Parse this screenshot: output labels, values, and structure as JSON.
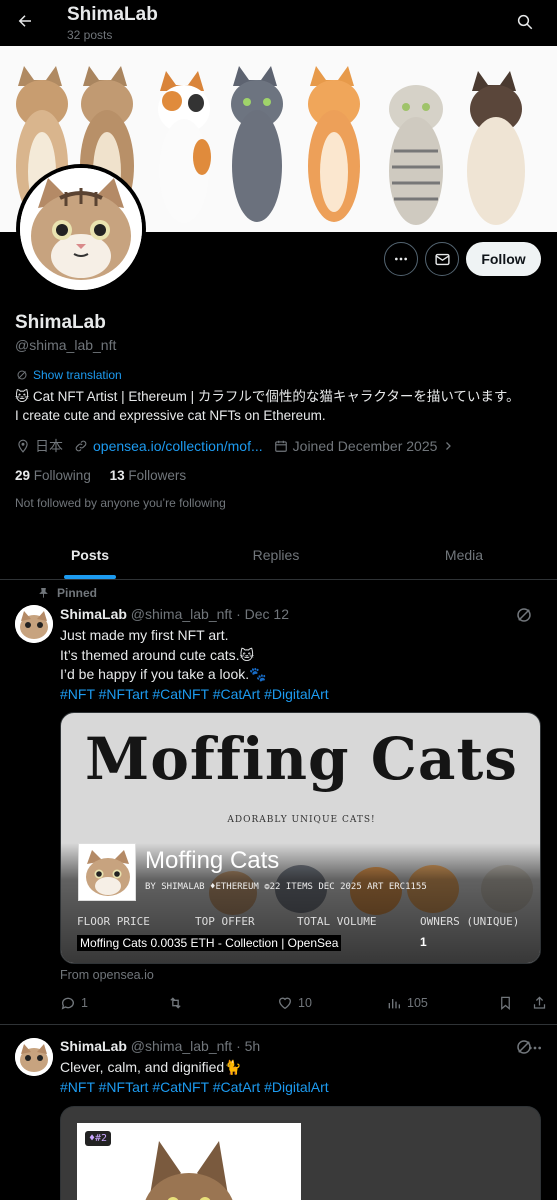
{
  "header": {
    "title": "ShimaLab",
    "posts_count": "32 posts"
  },
  "profile": {
    "name": "ShimaLab",
    "handle": "@shima_lab_nft",
    "show_translation": "Show translation",
    "bio_line1": "🐱 Cat NFT Artist | Ethereum | カラフルで個性的な猫キャラクターを描いています。",
    "bio_line2": "I create cute and expressive cat NFTs on Ethereum.",
    "location": "日本",
    "website": "opensea.io/collection/mof...",
    "joined": "Joined December 2025",
    "following_count": "29",
    "following_label": "Following",
    "followers_count": "13",
    "followers_label": "Followers",
    "not_followed": "Not followed by anyone you’re following",
    "follow_label": "Follow"
  },
  "tabs": [
    "Posts",
    "Replies",
    "Media"
  ],
  "posts": [
    {
      "pinned_label": "Pinned",
      "name": "ShimaLab",
      "handle": "@shima_lab_nft",
      "time": "· Dec 12",
      "line1": "Just made my first NFT art.",
      "line2": "It’s themed around cute cats.🐱",
      "line3": "I’d be happy if you take a look.🐾",
      "tags": "#NFT #NFTart #CatNFT #CatArt #DigitalArt",
      "card": {
        "headline": "Moffing Cats",
        "subtitle": "ADORABLY UNIQUE CATS!",
        "name": "Moffing Cats",
        "meta": "BY SHIMALAB  ♦ETHEREUM  ❂22 ITEMS  DEC 2025  ART  ERC1155",
        "stat1": "FLOOR PRICE",
        "stat2": "TOP OFFER",
        "stat3": "TOTAL VOLUME",
        "stat4": "OWNERS (UNIQUE)",
        "caption": "Moffing Cats 0.0035 ETH - Collection | OpenSea",
        "owners_value": "1"
      },
      "from": "From opensea.io",
      "replies": "1",
      "likes": "10",
      "views": "105"
    },
    {
      "name": "ShimaLab",
      "handle": "@shima_lab_nft",
      "time": "· 5h",
      "line1": "Clever, calm, and dignified🐈",
      "tags": "#NFT #NFTart #CatNFT #CatArt #DigitalArt",
      "badge": "♦#2"
    }
  ],
  "colors": {
    "background": "#000000",
    "accent": "#1d9bf0",
    "muted": "#71767b"
  }
}
